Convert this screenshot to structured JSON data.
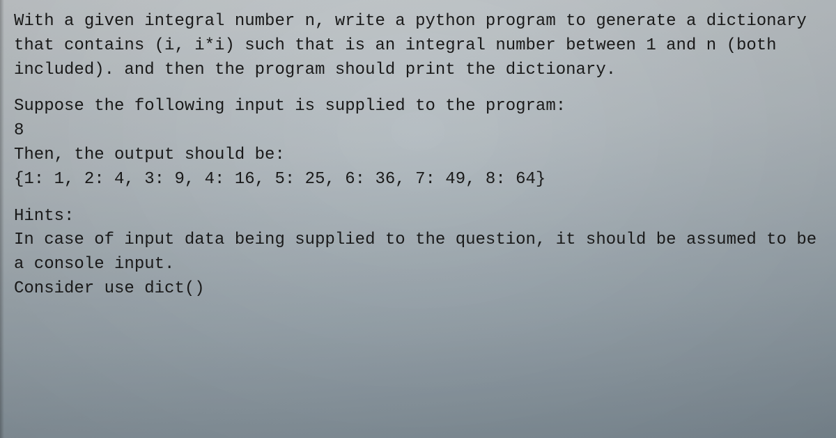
{
  "paragraphs": {
    "p1": "With a given integral number n, write a python program to generate a dictionary that contains (i, i*i) such that is an integral number between 1 and n (both included). and then the program should print the dictionary.",
    "p2": "Suppose the following input is supplied to the program:\n8\nThen, the output should be:\n{1: 1, 2: 4, 3: 9, 4: 16, 5: 25, 6: 36, 7: 49, 8: 64}",
    "p3": "Hints:\nIn case of input data being supplied to the question, it should be assumed to be a console input.\nConsider use dict()"
  }
}
